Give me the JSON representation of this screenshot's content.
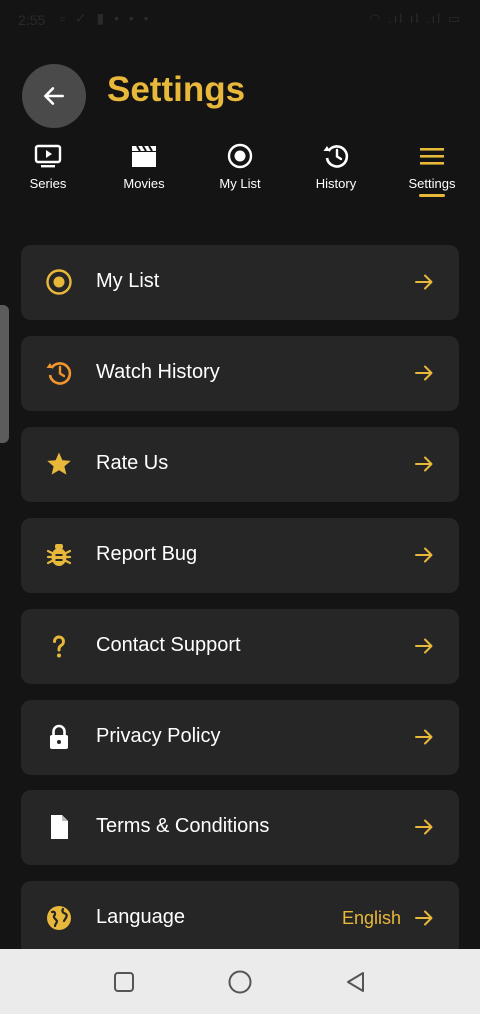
{
  "status_bar": {
    "time": "2:55",
    "left_icons": "▫ ✓ ▮ • • •",
    "right_icons": "◠ .ıl ıl .ıl ▭"
  },
  "header": {
    "title": "Settings",
    "back_icon": "arrow-left-icon"
  },
  "tabs": [
    {
      "label": "Series",
      "icon": "tv-play-icon"
    },
    {
      "label": "Movies",
      "icon": "clapperboard-icon"
    },
    {
      "label": "My List",
      "icon": "radio-target-icon"
    },
    {
      "label": "History",
      "icon": "history-icon"
    },
    {
      "label": "Settings",
      "icon": "menu-icon",
      "active": true
    }
  ],
  "menu": [
    {
      "label": "My List",
      "icon": "radio-target-icon"
    },
    {
      "label": "Watch History",
      "icon": "history-icon"
    },
    {
      "label": "Rate Us",
      "icon": "star-icon"
    },
    {
      "label": "Report Bug",
      "icon": "bug-icon"
    },
    {
      "label": "Contact Support",
      "icon": "question-icon"
    },
    {
      "label": "Privacy Policy",
      "icon": "lock-icon"
    },
    {
      "label": "Terms & Conditions",
      "icon": "document-icon"
    },
    {
      "label": "Language",
      "value": "English",
      "icon": "globe-icon"
    }
  ],
  "colors": {
    "accent": "#e8b83a",
    "orange": "#f0962e",
    "background": "#141414",
    "card": "#262626"
  },
  "nav_bar": {
    "buttons": [
      "square-recents-icon",
      "circle-home-icon",
      "triangle-back-icon"
    ]
  }
}
